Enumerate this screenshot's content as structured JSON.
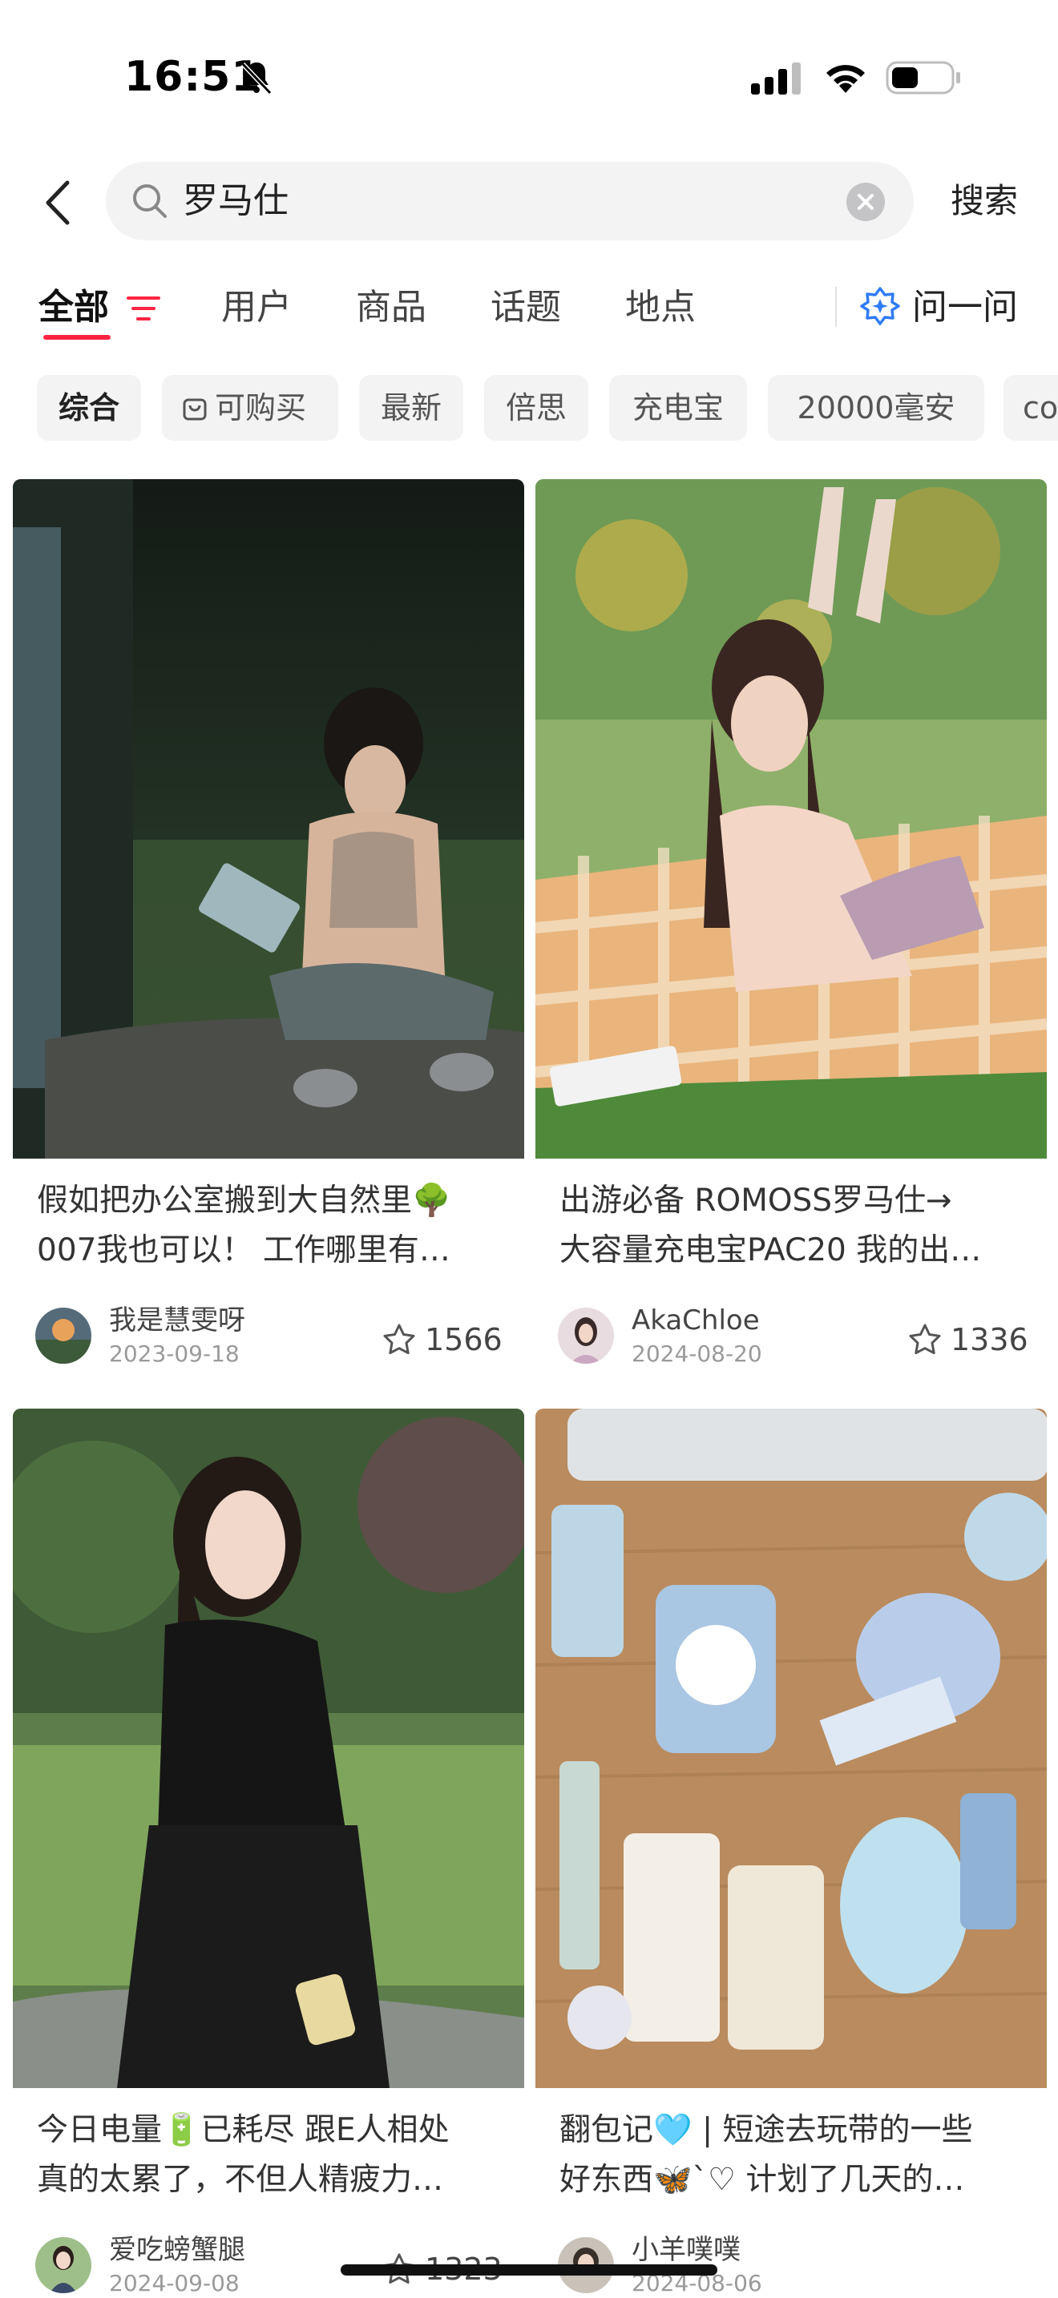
{
  "status_bar": {
    "time": "16:51"
  },
  "search": {
    "query": "罗马仕",
    "submit_label": "搜索"
  },
  "tabs": [
    {
      "label": "全部"
    },
    {
      "label": "用户"
    },
    {
      "label": "商品"
    },
    {
      "label": "话题"
    },
    {
      "label": "地点"
    }
  ],
  "ask_label": "问一问",
  "chips": [
    {
      "label": "综合"
    },
    {
      "label": "可购买"
    },
    {
      "label": "最新"
    },
    {
      "label": "倍思"
    },
    {
      "label": "充电宝"
    },
    {
      "label": "20000毫安"
    },
    {
      "label": "co"
    }
  ],
  "accent_color": "#ff2442",
  "cards": [
    {
      "title_line1": "假如把办公室搬到大自然里🌳",
      "title_line2": "007我也可以！ 工作哪里有…",
      "author": "我是慧雯呀",
      "date": "2023-09-18",
      "likes": "1566"
    },
    {
      "title_line1": "出游必备 ROMOSS罗马仕→",
      "title_line2": "大容量充电宝PAC20 我的出…",
      "author": "AkaChloe",
      "date": "2024-08-20",
      "likes": "1336"
    },
    {
      "title_line1": "今日电量🔋已耗尽 跟E人相处",
      "title_line2": "真的太累了，不但人精疲力…",
      "author": "爱吃螃蟹腿",
      "date": "2024-09-08",
      "likes": "1323"
    },
    {
      "title_line1": "翻包记🩵 | 短途去玩带的一些",
      "title_line2": "好东西🦋`♡ 计划了几天的…",
      "author": "小羊噗噗",
      "date": "2024-08-06",
      "likes": ""
    }
  ]
}
